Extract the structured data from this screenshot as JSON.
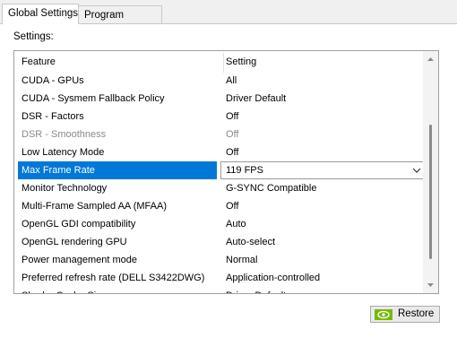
{
  "tabs": [
    {
      "label": "Global Settings",
      "active": true
    },
    {
      "label": "Program Settings",
      "active": false
    }
  ],
  "settings_label": "Settings:",
  "columns": {
    "feature": "Feature",
    "setting": "Setting"
  },
  "rows": [
    {
      "feature": "CUDA - GPUs",
      "setting": "All"
    },
    {
      "feature": "CUDA - Sysmem Fallback Policy",
      "setting": "Driver Default"
    },
    {
      "feature": "DSR - Factors",
      "setting": "Off"
    },
    {
      "feature": "DSR - Smoothness",
      "setting": "Off",
      "disabled": true
    },
    {
      "feature": "Low Latency Mode",
      "setting": "Off"
    },
    {
      "feature": "Max Frame Rate",
      "setting": "119 FPS",
      "selected": true
    },
    {
      "feature": "Monitor Technology",
      "setting": "G-SYNC Compatible"
    },
    {
      "feature": "Multi-Frame Sampled AA (MFAA)",
      "setting": "Off"
    },
    {
      "feature": "OpenGL GDI compatibility",
      "setting": "Auto"
    },
    {
      "feature": "OpenGL rendering GPU",
      "setting": "Auto-select"
    },
    {
      "feature": "Power management mode",
      "setting": "Normal"
    },
    {
      "feature": "Preferred refresh rate (DELL S3422DWG)",
      "setting": "Application-controlled"
    },
    {
      "feature": "Shader Cache Size",
      "setting": "Driver Default"
    }
  ],
  "restore_label": "Restore",
  "colors": {
    "selection": "#0078d7",
    "nvidia_green": "#76b900"
  }
}
